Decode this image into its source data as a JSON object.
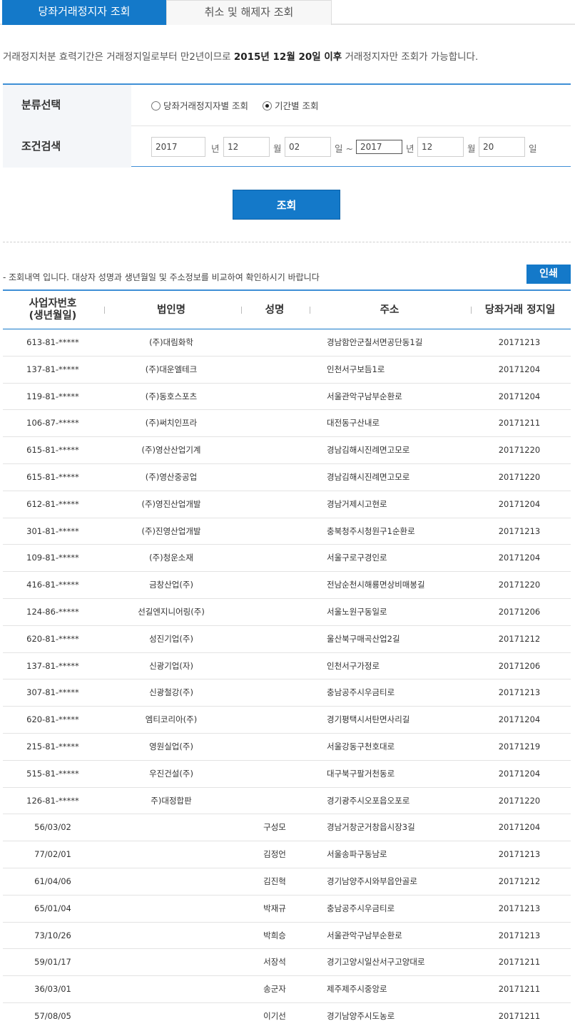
{
  "tabs": [
    {
      "label": "당좌거래정지자 조회",
      "active": true
    },
    {
      "label": "취소 및 해제자 조회",
      "active": false
    }
  ],
  "notice": {
    "pre": "거래정지처분 효력기간은 거래정지일로부터 만2년이므로 ",
    "bold": "2015년 12월 20일 이후",
    "post": " 거래정지자만 조회가 가능합니다."
  },
  "form": {
    "category_label": "분류선택",
    "radio_options": [
      {
        "label": "당좌거래정지자별 조회",
        "checked": false
      },
      {
        "label": "기간별 조회",
        "checked": true
      }
    ],
    "condition_label": "조건검색",
    "from": {
      "year": "2017",
      "month": "12",
      "day": "02"
    },
    "to": {
      "year": "2017",
      "month": "12",
      "day": "20"
    },
    "units": {
      "year": "년",
      "month": "월",
      "day": "일",
      "tilde": "일 ~"
    }
  },
  "search_button": "조회",
  "result_note": "- 조회내역 입니다. 대상자 성명과 생년월일 및 주소정보를 비교하여 확인하시기 바랍니다",
  "print_button": "인쇄",
  "table": {
    "headers": {
      "id_line1": "사업자번호",
      "id_line2": "(생년월일)",
      "corp": "법인명",
      "name": "성명",
      "addr": "주소",
      "date": "당좌거래 정지일"
    },
    "rows": [
      {
        "id": "613-81-*****",
        "corp": "(주)대림화학",
        "name": "",
        "addr": "경남함안군칠서면공단동1길",
        "date": "20171213"
      },
      {
        "id": "137-81-*****",
        "corp": "(주)대운엘테크",
        "name": "",
        "addr": "인천서구보듬1로",
        "date": "20171204"
      },
      {
        "id": "119-81-*****",
        "corp": "(주)동호스포츠",
        "name": "",
        "addr": "서울관악구남부순환로",
        "date": "20171204"
      },
      {
        "id": "106-87-*****",
        "corp": "(주)써치인프라",
        "name": "",
        "addr": "대전동구산내로",
        "date": "20171211"
      },
      {
        "id": "615-81-*****",
        "corp": "(주)영산산업기계",
        "name": "",
        "addr": "경남김해시진례면고모로",
        "date": "20171220"
      },
      {
        "id": "615-81-*****",
        "corp": "(주)영산중공업",
        "name": "",
        "addr": "경남김해시진례면고모로",
        "date": "20171220"
      },
      {
        "id": "612-81-*****",
        "corp": "(주)영진산업개발",
        "name": "",
        "addr": "경남거제시고현로",
        "date": "20171204"
      },
      {
        "id": "301-81-*****",
        "corp": "(주)진영산업개발",
        "name": "",
        "addr": "충북청주시청원구1순환로",
        "date": "20171213"
      },
      {
        "id": "109-81-*****",
        "corp": "(주)청운소재",
        "name": "",
        "addr": "서울구로구경인로",
        "date": "20171204"
      },
      {
        "id": "416-81-*****",
        "corp": "금창산업(주)",
        "name": "",
        "addr": "전남순천시해룡면상비매봉길",
        "date": "20171220"
      },
      {
        "id": "124-86-*****",
        "corp": "선길엔지니어링(주)",
        "name": "",
        "addr": "서울노원구동일로",
        "date": "20171206"
      },
      {
        "id": "620-81-*****",
        "corp": "성진기업(주)",
        "name": "",
        "addr": "울산북구매곡산업2길",
        "date": "20171212"
      },
      {
        "id": "137-81-*****",
        "corp": "신광기업(자)",
        "name": "",
        "addr": "인천서구가정로",
        "date": "20171206"
      },
      {
        "id": "307-81-*****",
        "corp": "신광철강(주)",
        "name": "",
        "addr": "충남공주시우금티로",
        "date": "20171213"
      },
      {
        "id": "620-81-*****",
        "corp": "엠티코리아(주)",
        "name": "",
        "addr": "경기평택시서탄면사리길",
        "date": "20171204"
      },
      {
        "id": "215-81-*****",
        "corp": "영원실업(주)",
        "name": "",
        "addr": "서울강동구천호대로",
        "date": "20171219"
      },
      {
        "id": "515-81-*****",
        "corp": "우진건설(주)",
        "name": "",
        "addr": "대구북구팔거천동로",
        "date": "20171204"
      },
      {
        "id": "126-81-*****",
        "corp": "주)대정합판",
        "name": "",
        "addr": "경기광주시오포읍오포로",
        "date": "20171220"
      },
      {
        "id": "56/03/02",
        "corp": "",
        "name": "구성모",
        "addr": "경남거창군거창읍시장3길",
        "date": "20171204"
      },
      {
        "id": "77/02/01",
        "corp": "",
        "name": "김정언",
        "addr": "서울송파구동남로",
        "date": "20171213"
      },
      {
        "id": "61/04/06",
        "corp": "",
        "name": "김진혁",
        "addr": "경기남양주시와부읍안골로",
        "date": "20171212"
      },
      {
        "id": "65/01/04",
        "corp": "",
        "name": "박재규",
        "addr": "충남공주시우금티로",
        "date": "20171213"
      },
      {
        "id": "73/10/26",
        "corp": "",
        "name": "박희승",
        "addr": "서울관악구남부순환로",
        "date": "20171213"
      },
      {
        "id": "59/01/17",
        "corp": "",
        "name": "서장석",
        "addr": "경기고양시일산서구고양대로",
        "date": "20171211"
      },
      {
        "id": "36/03/01",
        "corp": "",
        "name": "송군자",
        "addr": "제주제주시중앙로",
        "date": "20171211"
      },
      {
        "id": "57/08/05",
        "corp": "",
        "name": "이기선",
        "addr": "경기남양주시도농로",
        "date": "20171211"
      }
    ]
  }
}
